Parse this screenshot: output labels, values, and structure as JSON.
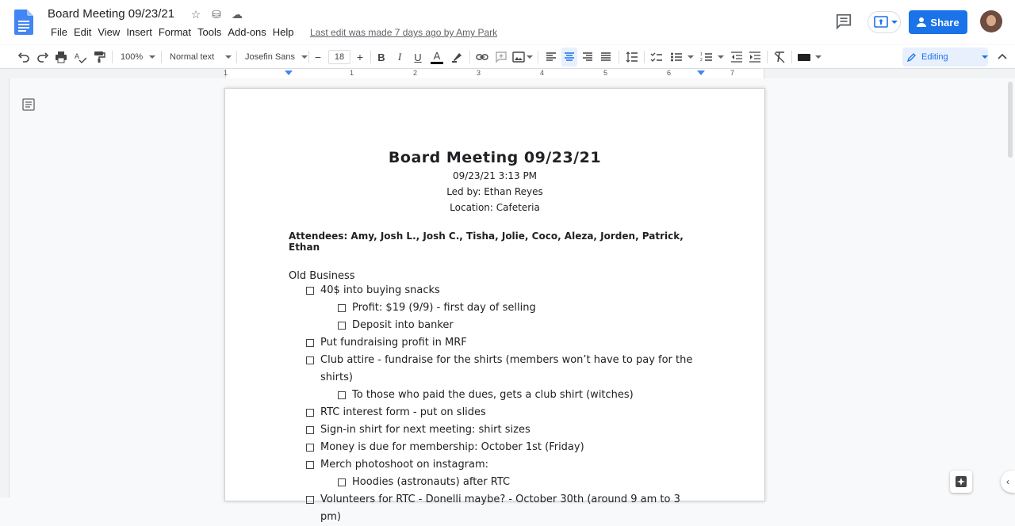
{
  "app": {
    "title": "Board Meeting 09/23/21",
    "last_edit": "Last edit was made 7 days ago by Amy Park",
    "share_label": "Share",
    "editing_label": "Editing"
  },
  "menu": [
    "File",
    "Edit",
    "View",
    "Insert",
    "Format",
    "Tools",
    "Add-ons",
    "Help"
  ],
  "toolbar": {
    "zoom": "100%",
    "style": "Normal text",
    "font": "Josefin Sans",
    "font_size": "18"
  },
  "ruler": [
    "1",
    "1",
    "2",
    "3",
    "4",
    "5",
    "6",
    "7"
  ],
  "document": {
    "title": "Board Meeting 09/23/21",
    "datetime": "09/23/21  3:13 PM",
    "led_by": "Led by: Ethan Reyes",
    "location": "Location: Cafeteria",
    "attendees": "Attendees: Amy, Josh L., Josh C., Tisha, Jolie, Coco, Aleza, Jorden, Patrick, Ethan",
    "section": "Old Business",
    "items": [
      {
        "level": 1,
        "text": "40$ into buying snacks"
      },
      {
        "level": 2,
        "text": "Profit: $19 (9/9) - first day of selling"
      },
      {
        "level": 2,
        "text": "Deposit into banker"
      },
      {
        "level": 1,
        "text": "Put fundraising profit in MRF"
      },
      {
        "level": 1,
        "text": "Club attire - fundraise for the shirts (members won’t have to pay for the shirts)"
      },
      {
        "level": 2,
        "text": "To those who paid the dues, gets a club shirt (witches)"
      },
      {
        "level": 1,
        "text": "RTC interest form - put on slides"
      },
      {
        "level": 1,
        "text": "Sign-in shirt for next meeting: shirt sizes"
      },
      {
        "level": 1,
        "text": "Money is due for membership: October 1st (Friday)"
      },
      {
        "level": 1,
        "text": "Merch photoshoot on instagram:"
      },
      {
        "level": 2,
        "text": "Hoodies (astronauts) after RTC"
      },
      {
        "level": 1,
        "text": "Volunteers for RTC - Donelli maybe? - October 30th (around 9 am to 3 pm)"
      }
    ]
  },
  "colors": {
    "accent": "#1a73e8",
    "doc_blue": "#4285f4"
  }
}
